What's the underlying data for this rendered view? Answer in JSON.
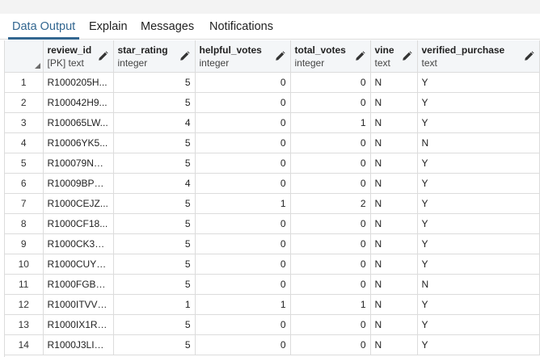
{
  "tabs": [
    {
      "label": "Data Output",
      "active": true
    },
    {
      "label": "Explain",
      "active": false
    },
    {
      "label": "Messages",
      "active": false
    },
    {
      "label": "Notifications",
      "active": false
    }
  ],
  "columns": [
    {
      "name": "review_id",
      "type": "[PK] text",
      "align": "txt"
    },
    {
      "name": "star_rating",
      "type": "integer",
      "align": "num"
    },
    {
      "name": "helpful_votes",
      "type": "integer",
      "align": "num"
    },
    {
      "name": "total_votes",
      "type": "integer",
      "align": "num"
    },
    {
      "name": "vine",
      "type": "text",
      "align": "txt"
    },
    {
      "name": "verified_purchase",
      "type": "text",
      "align": "txt"
    }
  ],
  "rows": [
    {
      "n": "1",
      "cells": [
        "R1000205H...",
        "5",
        "0",
        "0",
        "N",
        "Y"
      ]
    },
    {
      "n": "2",
      "cells": [
        "R100042H9...",
        "5",
        "0",
        "0",
        "N",
        "Y"
      ]
    },
    {
      "n": "3",
      "cells": [
        "R100065LW...",
        "4",
        "0",
        "1",
        "N",
        "Y"
      ]
    },
    {
      "n": "4",
      "cells": [
        "R10006YK5...",
        "5",
        "0",
        "0",
        "N",
        "N"
      ]
    },
    {
      "n": "5",
      "cells": [
        "R100079NQ...",
        "5",
        "0",
        "0",
        "N",
        "Y"
      ]
    },
    {
      "n": "6",
      "cells": [
        "R10009BPC...",
        "4",
        "0",
        "0",
        "N",
        "Y"
      ]
    },
    {
      "n": "7",
      "cells": [
        "R1000CEJZ...",
        "5",
        "1",
        "2",
        "N",
        "Y"
      ]
    },
    {
      "n": "8",
      "cells": [
        "R1000CF18...",
        "5",
        "0",
        "0",
        "N",
        "Y"
      ]
    },
    {
      "n": "9",
      "cells": [
        "R1000CK3G...",
        "5",
        "0",
        "0",
        "N",
        "Y"
      ]
    },
    {
      "n": "10",
      "cells": [
        "R1000CUYGI...",
        "5",
        "0",
        "0",
        "N",
        "Y"
      ]
    },
    {
      "n": "11",
      "cells": [
        "R1000FGBV...",
        "5",
        "0",
        "0",
        "N",
        "N"
      ]
    },
    {
      "n": "12",
      "cells": [
        "R1000ITVV8...",
        "1",
        "1",
        "1",
        "N",
        "Y"
      ]
    },
    {
      "n": "13",
      "cells": [
        "R1000IX1RK...",
        "5",
        "0",
        "0",
        "N",
        "Y"
      ]
    },
    {
      "n": "14",
      "cells": [
        "R1000J3LIH...",
        "5",
        "0",
        "0",
        "N",
        "Y"
      ]
    }
  ],
  "colors": {
    "accent": "#326690",
    "grid_line": "#dcdcdc",
    "header_bg": "#f4f6f8"
  },
  "icons": {
    "edit_column": "pencil-icon",
    "select_all": "select-all-corner-icon"
  }
}
